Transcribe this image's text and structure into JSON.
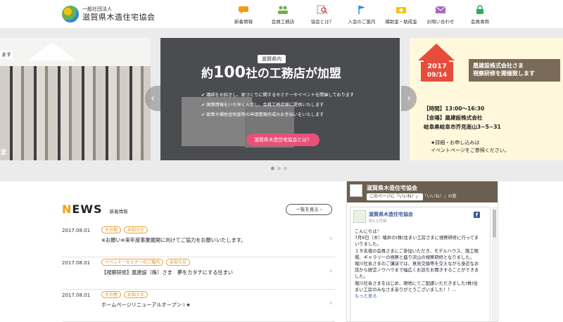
{
  "header": {
    "logo_small": "一般社団法人",
    "logo_big": "滋賀県木造住宅協会",
    "nav": [
      {
        "label": "新着情報",
        "icon": "megaphone-icon",
        "color": "#f39c12"
      },
      {
        "label": "会員工務店",
        "icon": "people-icon",
        "color": "#6ab04c"
      },
      {
        "label": "協会とは？",
        "icon": "magnifier-icon",
        "color": "#e74c3c"
      },
      {
        "label": "入会のご案内",
        "icon": "flag-icon",
        "color": "#2e86de"
      },
      {
        "label": "補助金・助成金",
        "icon": "money-icon",
        "color": "#f1c40f"
      },
      {
        "label": "お問い合わせ",
        "icon": "mail-icon",
        "color": "#a569bd"
      },
      {
        "label": "会員専用",
        "icon": "lock-icon",
        "color": "#27ae60"
      }
    ]
  },
  "slider": {
    "left": {
      "caption_top": "ます",
      "caption_bottom": "ま"
    },
    "main": {
      "badge": "滋賀県内",
      "headline_pre": "約",
      "headline_num": "100",
      "headline_post": "社の工務店が加盟",
      "bullets": [
        "講師をお招きし、家づくりに関するセミナーやイベントを開催しております",
        "国策情報をいち早く入手し、会員工務店様に提供いたします",
        "政策や補助金制度等の申請書類作成のお手伝いをいたします"
      ],
      "cta": "滋賀県木造住宅協会とは？"
    },
    "right": {
      "year": "2017",
      "date": "09/14",
      "title_line1": "凰建設株式会社さま",
      "title_line2": "視察研修を開催致します",
      "time": "【時間】13:00～16:30",
      "venue": "【会場】凰建設株式会社",
      "address": "岐阜県岐阜市芥見南山3−5−31",
      "note1": "★詳細・お申し込みは",
      "note2": "イベントページをご参照ください。"
    },
    "prev": "‹",
    "next": "›"
  },
  "news": {
    "title_first": "N",
    "title_rest": "EWS",
    "subtitle": "新着情報",
    "more": "一覧を見る ›",
    "items": [
      {
        "date": "2017.08.01",
        "tags": [
          "その他",
          "お知らせ"
        ],
        "text": "※お願い※来年度事業展開に向けてご協力をお願いいたします。"
      },
      {
        "date": "2017.08.01",
        "tags": [
          "イベント・セミナーのご案内",
          "お知らせ"
        ],
        "text": "【視察研修】凰建設（株）さま　夢をカタチにする住まい"
      },
      {
        "date": "2017.08.01",
        "tags": [
          "その他",
          "お知らせ"
        ],
        "text": "ホームページリニューアルオープン☆★"
      }
    ]
  },
  "facebook": {
    "page_name": "滋賀県木造住宅協会",
    "like_label": "このページに「いいね！」",
    "like_count": "23「いいね！」の数",
    "post_name": "滋賀県木造住宅協会",
    "post_time": "約1ヵ月前",
    "body": [
      "こんにちは！",
      "7月6日（木）壊井の(株)住まい工房さまに視察研修に行ってまいりました。",
      "１９名様の会員さまにご参加いただき、モデルハウス、施工現場、ギャラリーの視察と盛り沢山の視察研修となりました。",
      "堀川社長さまのご講演では、意見交換等を交えながら身近なお話から経営ノウハウまで幅広くお話をお聞きすることができました。",
      "堀川社長さまをはじめ、現地にてご配慮いただきました(株)住まい工房のみなさまありがとうございました！！..."
    ],
    "more_link": "もっと見る"
  }
}
